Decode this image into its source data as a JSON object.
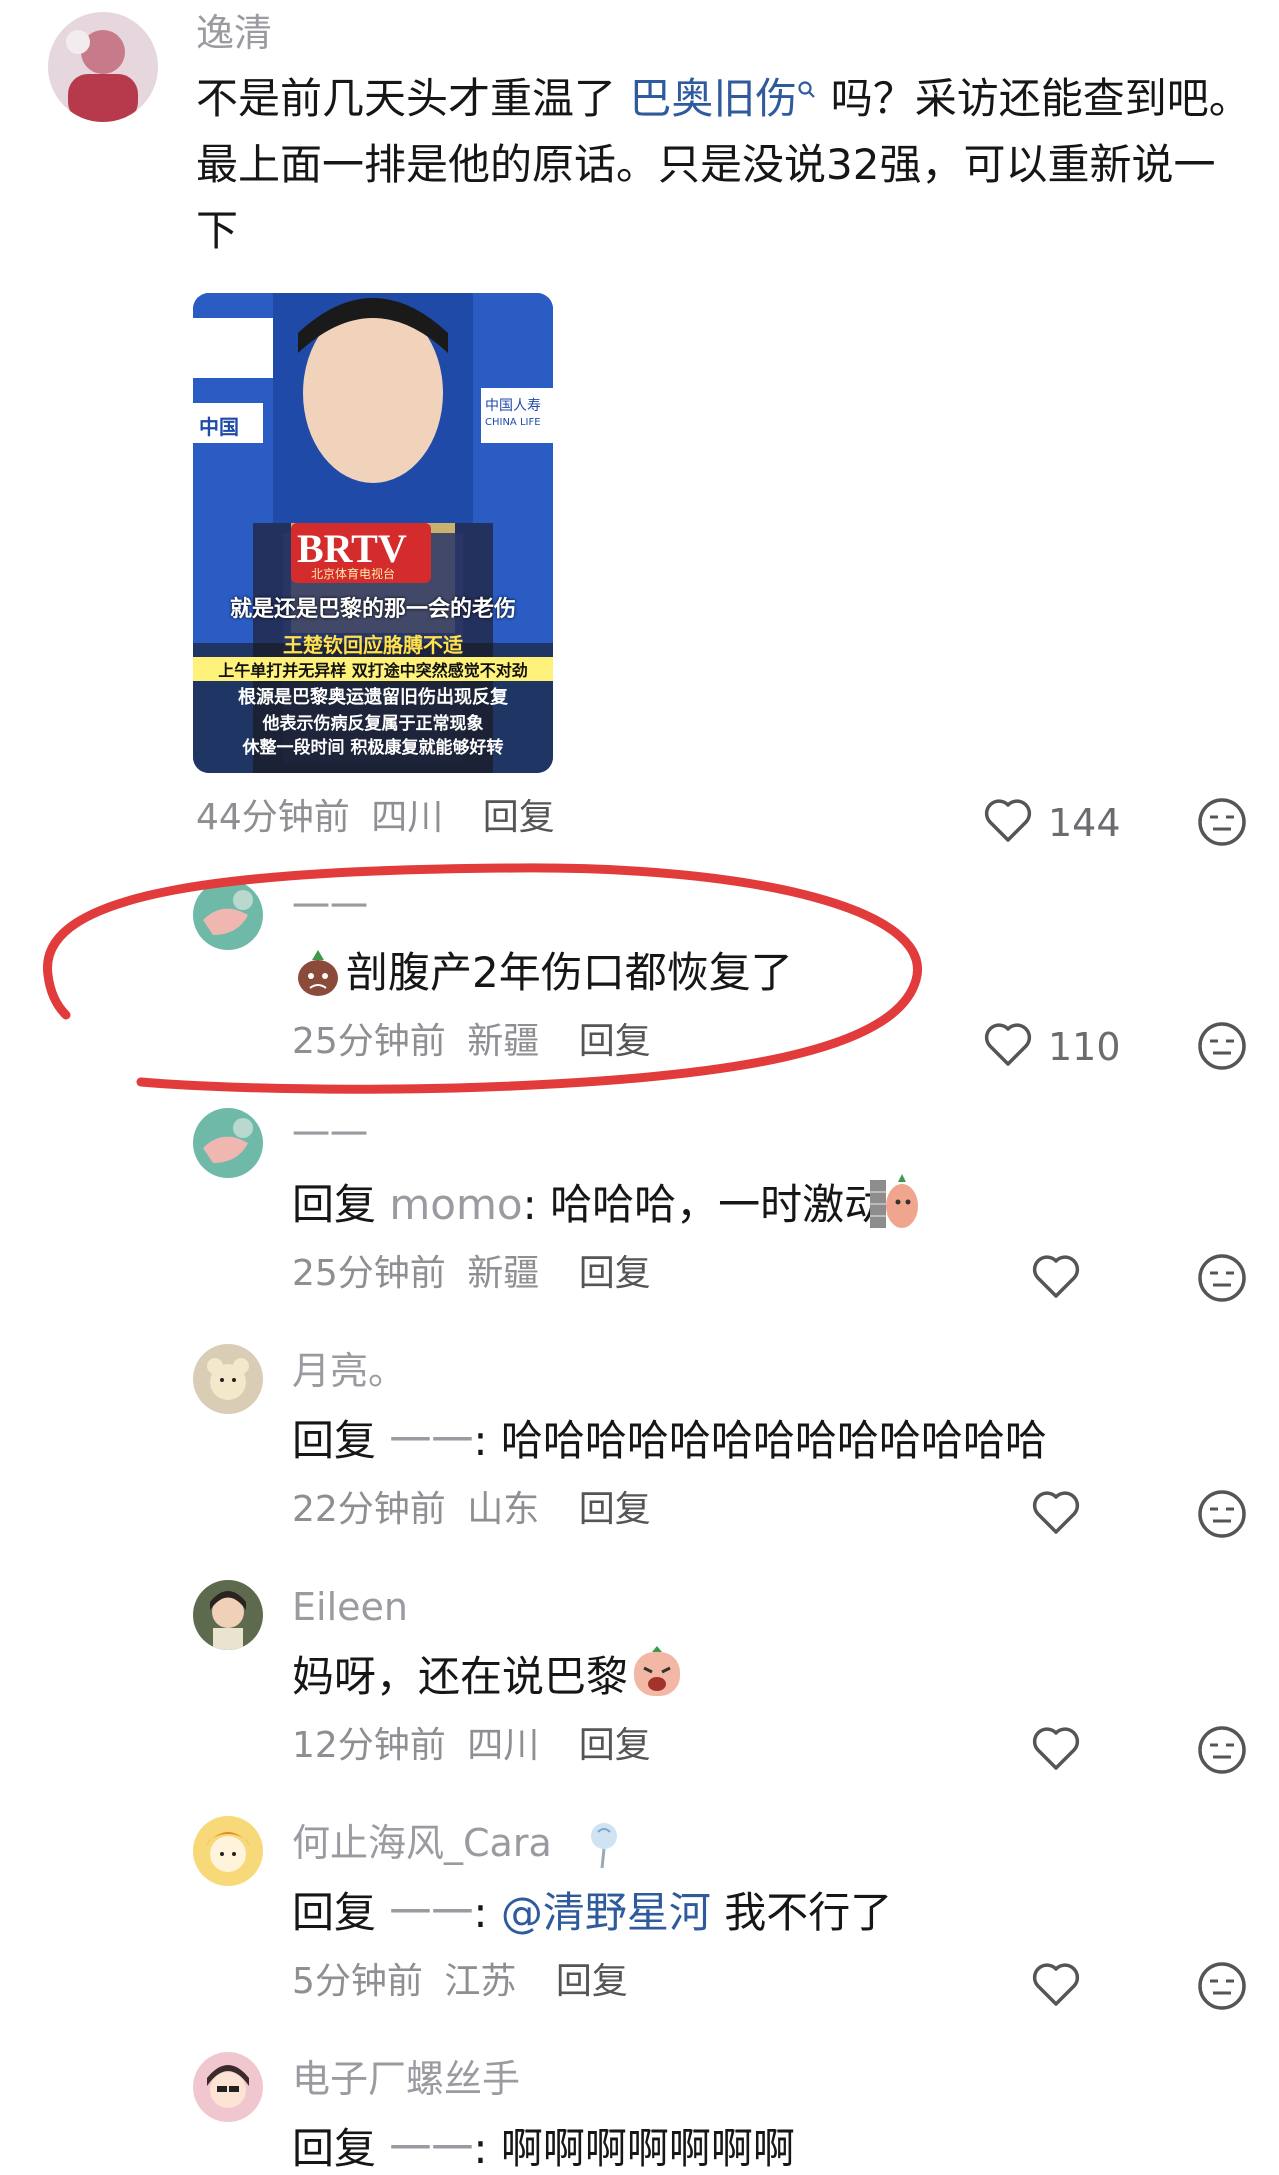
{
  "comments": [
    {
      "user": "逸清",
      "text_pre": "不是前几天头才重温了 ",
      "link": "巴奥旧伤",
      "text_line1_post": " 吗？采访还能查到吧。",
      "text_line2": "最上面一排是他的原话。只是没说32强，可以重新说一",
      "text_line3": "下",
      "time": "44分钟前",
      "location": "四川",
      "reply": "回复",
      "likes": "144",
      "video": {
        "logo": "BRTV",
        "logo_sub": "北京体育电视台",
        "left_sponsor": "中国",
        "right_sponsor": "中国人寿",
        "right_sponsor_sub": "CHINA LIFE",
        "subtitle": "就是还是巴黎的那一会的老伤",
        "caption_title": "王楚钦回应胳膊不适",
        "caption_1": "上午单打并无异样 双打途中突然感觉不对劲",
        "caption_2": "根源是巴黎奥运遗留旧伤出现反复",
        "caption_3": "他表示伤病反复属于正常现象",
        "caption_4": "休整一段时间 积极康复就能够好转"
      }
    },
    {
      "user": "一一",
      "text": "剖腹产2年伤口都恢复了",
      "time": "25分钟前",
      "location": "新疆",
      "reply": "回复",
      "likes": "110"
    },
    {
      "user": "一一",
      "reply_prefix": "回复 ",
      "reply_to": "momo",
      "text": ": 哈哈哈，一时激动",
      "time": "25分钟前",
      "location": "新疆",
      "reply": "回复"
    },
    {
      "user": "月亮。",
      "reply_prefix": "回复 ",
      "reply_to": "一一",
      "text": ": 哈哈哈哈哈哈哈哈哈哈哈哈哈",
      "time": "22分钟前",
      "location": "山东",
      "reply": "回复"
    },
    {
      "user": "Eileen",
      "text": "妈呀，还在说巴黎",
      "time": "12分钟前",
      "location": "四川",
      "reply": "回复"
    },
    {
      "user": "何止海风_Cara",
      "reply_prefix": "回复 ",
      "reply_to": "一一",
      "colon": ": ",
      "mention": "@清野星河",
      "text": " 我不行了",
      "time": "5分钟前",
      "location": "江苏",
      "reply": "回复"
    },
    {
      "user": "电子厂螺丝手",
      "reply_prefix": "回复 ",
      "reply_to": "一一",
      "text": ": 啊啊啊啊啊啊啊"
    }
  ],
  "colors": {
    "annotation": "#e23b3b",
    "link": "#2f5b9d",
    "meta": "#8e8e93"
  },
  "icons": [
    "heart-icon",
    "dislike-face-icon",
    "search-icon",
    "emoji"
  ]
}
